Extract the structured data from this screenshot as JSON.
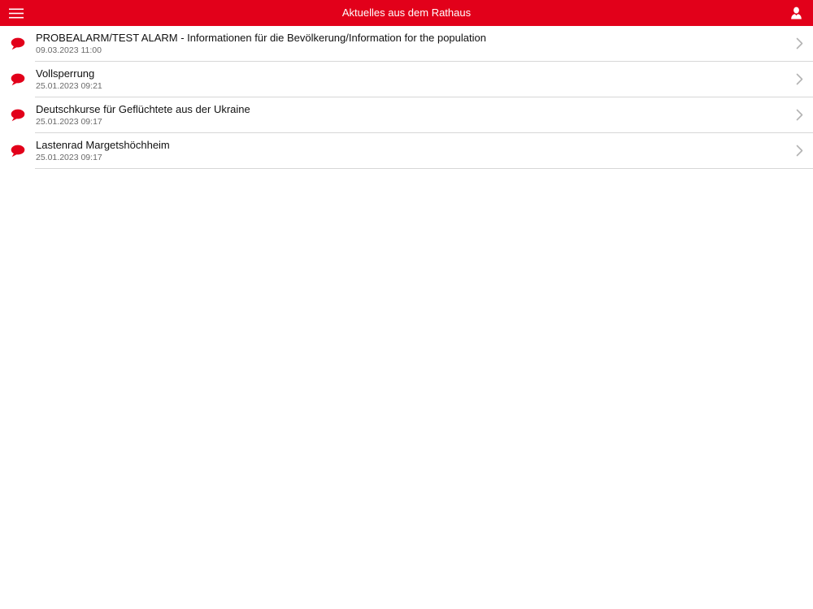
{
  "colors": {
    "accent": "#e2001a",
    "header_text": "#ffffff",
    "separator": "#d7d7d7",
    "chevron": "#b3b3b3",
    "date_text": "#6a6a6a"
  },
  "header": {
    "title": "Aktuelles aus dem Rathaus",
    "left_icon": "hamburger-menu-icon",
    "right_icon": "user-icon"
  },
  "news": {
    "item_icon": "speech-bubble-icon",
    "trailing_icon": "chevron-right-icon",
    "items": [
      {
        "title": "PROBEALARM/TEST ALARM - Informationen für die Bevölkerung/Information for the population",
        "date": "09.03.2023 11:00"
      },
      {
        "title": "Vollsperrung",
        "date": "25.01.2023 09:21"
      },
      {
        "title": "Deutschkurse für Geflüchtete aus der Ukraine",
        "date": "25.01.2023 09:17"
      },
      {
        "title": "Lastenrad Margetshöchheim",
        "date": "25.01.2023 09:17"
      }
    ]
  }
}
